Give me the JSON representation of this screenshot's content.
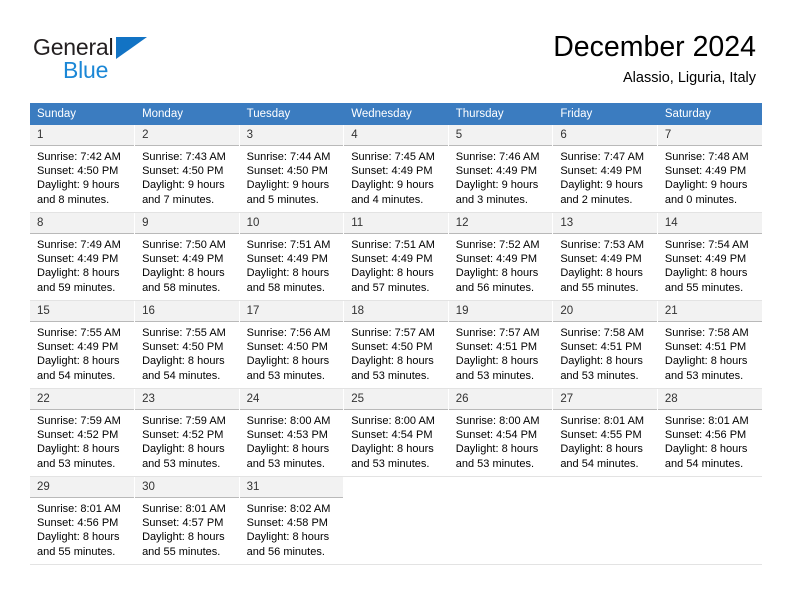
{
  "brand": {
    "name_top": "General",
    "name_bottom": "Blue",
    "triangle_color": "#1273c4",
    "blue_text_color": "#1b87d6"
  },
  "header": {
    "title": "December 2024",
    "subtitle": "Alassio, Liguria, Italy",
    "header_bg_color": "#3b7cc0",
    "daynum_bg_color": "#f2f2f2"
  },
  "weekdays": [
    "Sunday",
    "Monday",
    "Tuesday",
    "Wednesday",
    "Thursday",
    "Friday",
    "Saturday"
  ],
  "labels": {
    "sunrise_prefix": "Sunrise:",
    "sunset_prefix": "Sunset:",
    "daylight_prefix": "Daylight:"
  },
  "weeks": [
    [
      {
        "day": "1",
        "sunrise": "Sunrise: 7:42 AM",
        "sunset": "Sunset: 4:50 PM",
        "daylight_line1": "Daylight: 9 hours",
        "daylight_line2": "and 8 minutes."
      },
      {
        "day": "2",
        "sunrise": "Sunrise: 7:43 AM",
        "sunset": "Sunset: 4:50 PM",
        "daylight_line1": "Daylight: 9 hours",
        "daylight_line2": "and 7 minutes."
      },
      {
        "day": "3",
        "sunrise": "Sunrise: 7:44 AM",
        "sunset": "Sunset: 4:50 PM",
        "daylight_line1": "Daylight: 9 hours",
        "daylight_line2": "and 5 minutes."
      },
      {
        "day": "4",
        "sunrise": "Sunrise: 7:45 AM",
        "sunset": "Sunset: 4:49 PM",
        "daylight_line1": "Daylight: 9 hours",
        "daylight_line2": "and 4 minutes."
      },
      {
        "day": "5",
        "sunrise": "Sunrise: 7:46 AM",
        "sunset": "Sunset: 4:49 PM",
        "daylight_line1": "Daylight: 9 hours",
        "daylight_line2": "and 3 minutes."
      },
      {
        "day": "6",
        "sunrise": "Sunrise: 7:47 AM",
        "sunset": "Sunset: 4:49 PM",
        "daylight_line1": "Daylight: 9 hours",
        "daylight_line2": "and 2 minutes."
      },
      {
        "day": "7",
        "sunrise": "Sunrise: 7:48 AM",
        "sunset": "Sunset: 4:49 PM",
        "daylight_line1": "Daylight: 9 hours",
        "daylight_line2": "and 0 minutes."
      }
    ],
    [
      {
        "day": "8",
        "sunrise": "Sunrise: 7:49 AM",
        "sunset": "Sunset: 4:49 PM",
        "daylight_line1": "Daylight: 8 hours",
        "daylight_line2": "and 59 minutes."
      },
      {
        "day": "9",
        "sunrise": "Sunrise: 7:50 AM",
        "sunset": "Sunset: 4:49 PM",
        "daylight_line1": "Daylight: 8 hours",
        "daylight_line2": "and 58 minutes."
      },
      {
        "day": "10",
        "sunrise": "Sunrise: 7:51 AM",
        "sunset": "Sunset: 4:49 PM",
        "daylight_line1": "Daylight: 8 hours",
        "daylight_line2": "and 58 minutes."
      },
      {
        "day": "11",
        "sunrise": "Sunrise: 7:51 AM",
        "sunset": "Sunset: 4:49 PM",
        "daylight_line1": "Daylight: 8 hours",
        "daylight_line2": "and 57 minutes."
      },
      {
        "day": "12",
        "sunrise": "Sunrise: 7:52 AM",
        "sunset": "Sunset: 4:49 PM",
        "daylight_line1": "Daylight: 8 hours",
        "daylight_line2": "and 56 minutes."
      },
      {
        "day": "13",
        "sunrise": "Sunrise: 7:53 AM",
        "sunset": "Sunset: 4:49 PM",
        "daylight_line1": "Daylight: 8 hours",
        "daylight_line2": "and 55 minutes."
      },
      {
        "day": "14",
        "sunrise": "Sunrise: 7:54 AM",
        "sunset": "Sunset: 4:49 PM",
        "daylight_line1": "Daylight: 8 hours",
        "daylight_line2": "and 55 minutes."
      }
    ],
    [
      {
        "day": "15",
        "sunrise": "Sunrise: 7:55 AM",
        "sunset": "Sunset: 4:49 PM",
        "daylight_line1": "Daylight: 8 hours",
        "daylight_line2": "and 54 minutes."
      },
      {
        "day": "16",
        "sunrise": "Sunrise: 7:55 AM",
        "sunset": "Sunset: 4:50 PM",
        "daylight_line1": "Daylight: 8 hours",
        "daylight_line2": "and 54 minutes."
      },
      {
        "day": "17",
        "sunrise": "Sunrise: 7:56 AM",
        "sunset": "Sunset: 4:50 PM",
        "daylight_line1": "Daylight: 8 hours",
        "daylight_line2": "and 53 minutes."
      },
      {
        "day": "18",
        "sunrise": "Sunrise: 7:57 AM",
        "sunset": "Sunset: 4:50 PM",
        "daylight_line1": "Daylight: 8 hours",
        "daylight_line2": "and 53 minutes."
      },
      {
        "day": "19",
        "sunrise": "Sunrise: 7:57 AM",
        "sunset": "Sunset: 4:51 PM",
        "daylight_line1": "Daylight: 8 hours",
        "daylight_line2": "and 53 minutes."
      },
      {
        "day": "20",
        "sunrise": "Sunrise: 7:58 AM",
        "sunset": "Sunset: 4:51 PM",
        "daylight_line1": "Daylight: 8 hours",
        "daylight_line2": "and 53 minutes."
      },
      {
        "day": "21",
        "sunrise": "Sunrise: 7:58 AM",
        "sunset": "Sunset: 4:51 PM",
        "daylight_line1": "Daylight: 8 hours",
        "daylight_line2": "and 53 minutes."
      }
    ],
    [
      {
        "day": "22",
        "sunrise": "Sunrise: 7:59 AM",
        "sunset": "Sunset: 4:52 PM",
        "daylight_line1": "Daylight: 8 hours",
        "daylight_line2": "and 53 minutes."
      },
      {
        "day": "23",
        "sunrise": "Sunrise: 7:59 AM",
        "sunset": "Sunset: 4:52 PM",
        "daylight_line1": "Daylight: 8 hours",
        "daylight_line2": "and 53 minutes."
      },
      {
        "day": "24",
        "sunrise": "Sunrise: 8:00 AM",
        "sunset": "Sunset: 4:53 PM",
        "daylight_line1": "Daylight: 8 hours",
        "daylight_line2": "and 53 minutes."
      },
      {
        "day": "25",
        "sunrise": "Sunrise: 8:00 AM",
        "sunset": "Sunset: 4:54 PM",
        "daylight_line1": "Daylight: 8 hours",
        "daylight_line2": "and 53 minutes."
      },
      {
        "day": "26",
        "sunrise": "Sunrise: 8:00 AM",
        "sunset": "Sunset: 4:54 PM",
        "daylight_line1": "Daylight: 8 hours",
        "daylight_line2": "and 53 minutes."
      },
      {
        "day": "27",
        "sunrise": "Sunrise: 8:01 AM",
        "sunset": "Sunset: 4:55 PM",
        "daylight_line1": "Daylight: 8 hours",
        "daylight_line2": "and 54 minutes."
      },
      {
        "day": "28",
        "sunrise": "Sunrise: 8:01 AM",
        "sunset": "Sunset: 4:56 PM",
        "daylight_line1": "Daylight: 8 hours",
        "daylight_line2": "and 54 minutes."
      }
    ],
    [
      {
        "day": "29",
        "sunrise": "Sunrise: 8:01 AM",
        "sunset": "Sunset: 4:56 PM",
        "daylight_line1": "Daylight: 8 hours",
        "daylight_line2": "and 55 minutes."
      },
      {
        "day": "30",
        "sunrise": "Sunrise: 8:01 AM",
        "sunset": "Sunset: 4:57 PM",
        "daylight_line1": "Daylight: 8 hours",
        "daylight_line2": "and 55 minutes."
      },
      {
        "day": "31",
        "sunrise": "Sunrise: 8:02 AM",
        "sunset": "Sunset: 4:58 PM",
        "daylight_line1": "Daylight: 8 hours",
        "daylight_line2": "and 56 minutes."
      },
      {
        "day": "",
        "sunrise": "",
        "sunset": "",
        "daylight_line1": "",
        "daylight_line2": ""
      },
      {
        "day": "",
        "sunrise": "",
        "sunset": "",
        "daylight_line1": "",
        "daylight_line2": ""
      },
      {
        "day": "",
        "sunrise": "",
        "sunset": "",
        "daylight_line1": "",
        "daylight_line2": ""
      },
      {
        "day": "",
        "sunrise": "",
        "sunset": "",
        "daylight_line1": "",
        "daylight_line2": ""
      }
    ]
  ]
}
